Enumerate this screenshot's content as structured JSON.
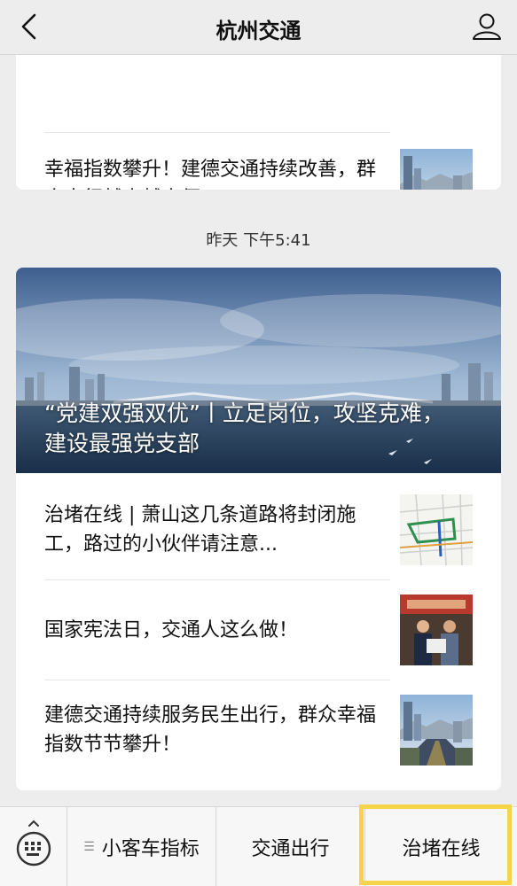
{
  "nav": {
    "title": "杭州交通",
    "back_icon": "chevron-left-icon",
    "profile_icon": "user-icon"
  },
  "feed": {
    "top_card": {
      "articles": [
        {
          "title": "幸福指数攀升！建德交通持续改善，群众出行越来越方便！"
        }
      ]
    },
    "timestamp": "昨天 下午5:41",
    "main_card": {
      "hero_title": "“党建双强双优”丨立足岗位，攻坚克难，建设最强党支部",
      "articles": [
        {
          "title": "治堵在线 | 萧山这几条道路将封闭施工，路过的小伙伴请注意..."
        },
        {
          "title": "国家宪法日，交通人这么做！"
        },
        {
          "title": "建德交通持续服务民生出行，群众幸福指数节节攀升！"
        }
      ]
    }
  },
  "tabbar": {
    "keyboard_icon": "keyboard-icon",
    "menu_icon": "menu-lines-icon",
    "tabs": [
      {
        "label": "小客车指标"
      },
      {
        "label": "交通出行"
      },
      {
        "label": "治堵在线"
      }
    ],
    "highlight_color": "#f5d34a"
  }
}
